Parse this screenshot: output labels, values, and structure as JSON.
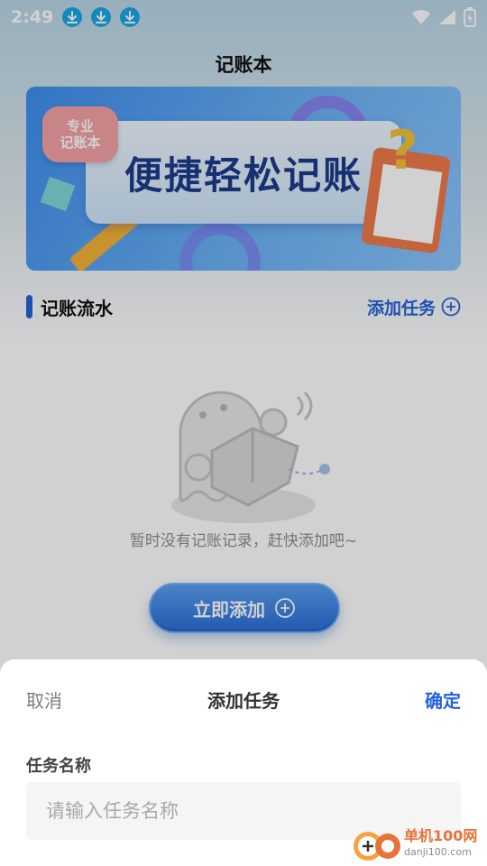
{
  "status_bar": {
    "time": "2:49",
    "download_icons": [
      "download-icon",
      "download-icon",
      "download-icon"
    ],
    "right_icons": [
      "wifi-icon",
      "signal-icon",
      "battery-icon"
    ]
  },
  "header": {
    "title": "记账本"
  },
  "banner": {
    "tag_line1": "专业",
    "tag_line2": "记账本",
    "headline": "便捷轻松记账"
  },
  "section": {
    "title": "记账流水",
    "add_task_label": "添加任务"
  },
  "empty_state": {
    "message": "暂时没有记账记录，赶快添加吧~",
    "add_button_label": "立即添加"
  },
  "sheet": {
    "cancel_label": "取消",
    "title": "添加任务",
    "confirm_label": "确定",
    "field_label": "任务名称",
    "field_placeholder": "请输入任务名称",
    "field_value": ""
  },
  "watermark": {
    "main": "单机100网",
    "sub": "danji100.com"
  },
  "colors": {
    "accent": "#2563d9",
    "button_gradient_top": "#5aa0f2",
    "button_gradient_bottom": "#2a6fd8",
    "muted_text": "#8f8f8f"
  }
}
